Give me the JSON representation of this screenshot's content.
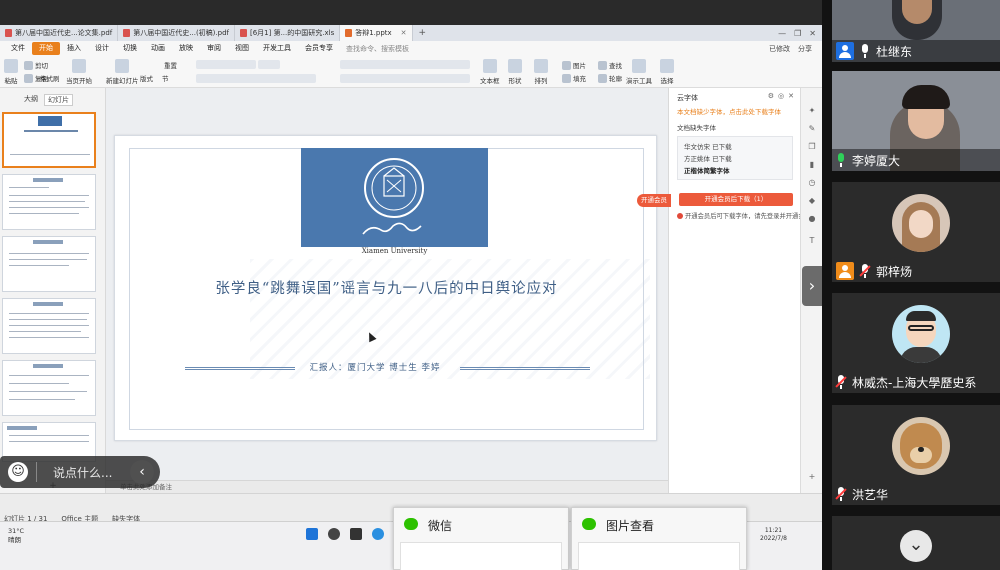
{
  "browser_tabs": [
    {
      "label": "第八届中国近代史...论文集.pdf",
      "type": "pdf"
    },
    {
      "label": "第八届中国近代史...(初稿).pdf",
      "type": "pdf"
    },
    {
      "label": "[6月1] 第...的中国研究.xls",
      "type": "pdf"
    },
    {
      "label": "答辩1.pptx",
      "type": "ppt",
      "active": true
    }
  ],
  "menu": {
    "file": "文件",
    "start": "开始",
    "items": [
      "插入",
      "设计",
      "切换",
      "动画",
      "放映",
      "审阅",
      "视图",
      "开发工具",
      "会员专享"
    ],
    "search": "查找命令、搜索模板",
    "right": [
      "已修改",
      "分享"
    ]
  },
  "ribbon": {
    "paste": "粘贴",
    "cut": "剪切",
    "copy": "复制",
    "format_painter": "格式刷",
    "from_current": "当页开始",
    "new_slide": "新建幻灯片",
    "layout": "版式",
    "section": "节",
    "reset": "重置",
    "textbox": "文本框",
    "shape": "形状",
    "arrange": "排列",
    "picture": "图片",
    "fill": "填充",
    "outline": "轮廓",
    "find": "查找",
    "presentation_tools": "演示工具",
    "select": "选择"
  },
  "left_panel": {
    "tab_outline": "大纲",
    "tab_slides": "幻灯片",
    "add": "+"
  },
  "slide": {
    "university_en": "Xiamen University",
    "title": "张学良“跳舞误国”谣言与九一八后的中日舆论应对",
    "reporter": "汇报人：厦门大学 博士生 李婷"
  },
  "canvas_note": "单击此处添加备注",
  "font_panel": {
    "header": "云字体",
    "sub": "本文档缺少字体，点击此处下载字体",
    "missing_title": "文档缺失字体",
    "font_1": "华文仿宋 已下载",
    "font_2": "方正姚体 已下载",
    "font_3": "正楷体简繁字体",
    "download_btn": "开通会员后下载（1）",
    "note": "开通会员后可下载字体，请先登录并开通会员",
    "float_tag": "开通会员"
  },
  "status": {
    "slide_counter": "幻灯片 1 / 31",
    "theme": "Office 主题",
    "missing_font": "缺失字体"
  },
  "taskbar": {
    "weather_temp": "31°C",
    "weather_desc": "晴朗",
    "time": "11:21",
    "date": "2022/7/8"
  },
  "chat": {
    "placeholder": "说点什么..."
  },
  "windows": {
    "wechat": "微信",
    "image_viewer": "图片查看"
  },
  "participants": [
    {
      "name": "杜继东",
      "mic": "on",
      "kind": "video",
      "avatar_badge": true
    },
    {
      "name": "李婷厦大",
      "mic": "speaking",
      "kind": "video"
    },
    {
      "name": "郭梓炀",
      "mic": "muted",
      "kind": "avatar",
      "avatar_badge": true
    },
    {
      "name": "林威杰-上海大學歷史系",
      "mic": "muted",
      "kind": "avatar"
    },
    {
      "name": "洪艺华",
      "mic": "muted",
      "kind": "avatar"
    },
    {
      "name": "",
      "mic": "off",
      "kind": "avatar"
    }
  ],
  "colors": {
    "accent_orange": "#e9801c",
    "slide_blue": "#4a78ae",
    "title_blue": "#3f5f86",
    "download_red": "#ec5a3b"
  }
}
